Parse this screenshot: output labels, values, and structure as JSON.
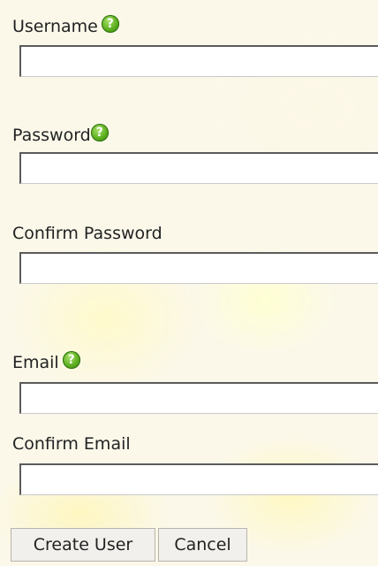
{
  "form": {
    "username": {
      "label": "Username",
      "value": ""
    },
    "password": {
      "label": "Password",
      "value": ""
    },
    "confirm_password": {
      "label": "Confirm Password",
      "value": ""
    },
    "email": {
      "label": "Email",
      "value": ""
    },
    "confirm_email": {
      "label": "Confirm Email",
      "value": ""
    },
    "help_icon_glyph": "?",
    "icons": {
      "help": "help-question-icon"
    }
  },
  "buttons": {
    "create_user": "Create User",
    "cancel": "Cancel"
  },
  "colors": {
    "help_icon": "#5cae1e",
    "background": "#fbf8ea"
  }
}
